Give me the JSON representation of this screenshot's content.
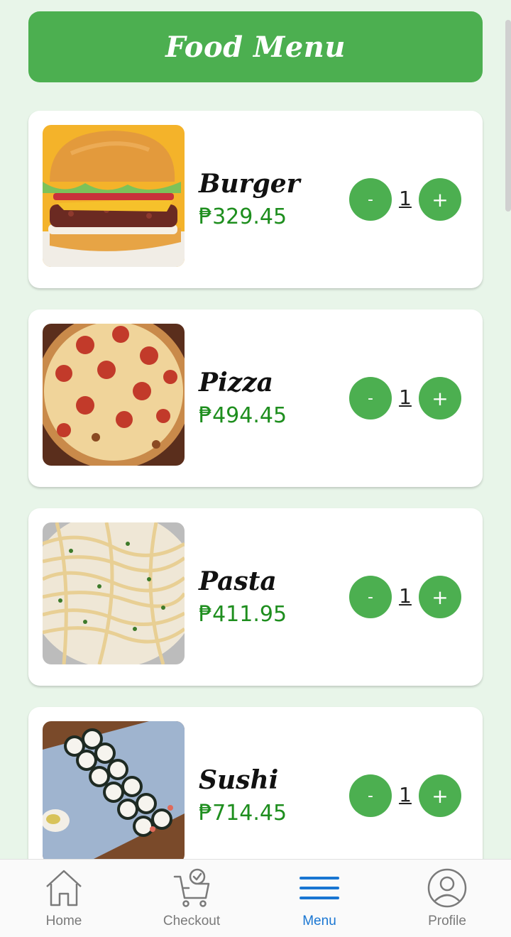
{
  "header": {
    "title": "Food Menu"
  },
  "items": [
    {
      "name": "Burger",
      "price": "₱329.45",
      "quantity": "1",
      "minus_label": "-",
      "plus_label": "+"
    },
    {
      "name": "Pizza",
      "price": "₱494.45",
      "quantity": "1",
      "minus_label": "-",
      "plus_label": "+"
    },
    {
      "name": "Pasta",
      "price": "₱411.95",
      "quantity": "1",
      "minus_label": "-",
      "plus_label": "+"
    },
    {
      "name": "Sushi",
      "price": "₱714.45",
      "quantity": "1",
      "minus_label": "-",
      "plus_label": "+"
    }
  ],
  "nav": {
    "items": [
      {
        "label": "Home",
        "icon": "home-icon"
      },
      {
        "label": "Checkout",
        "icon": "cart-check-icon"
      },
      {
        "label": "Menu",
        "icon": "menu-icon"
      },
      {
        "label": "Profile",
        "icon": "profile-icon"
      }
    ],
    "active": "Menu"
  },
  "colors": {
    "background": "#e8f5e9",
    "primary_green": "#4caf50",
    "price_green": "#1e8e1e",
    "active_nav": "#1976d2"
  }
}
